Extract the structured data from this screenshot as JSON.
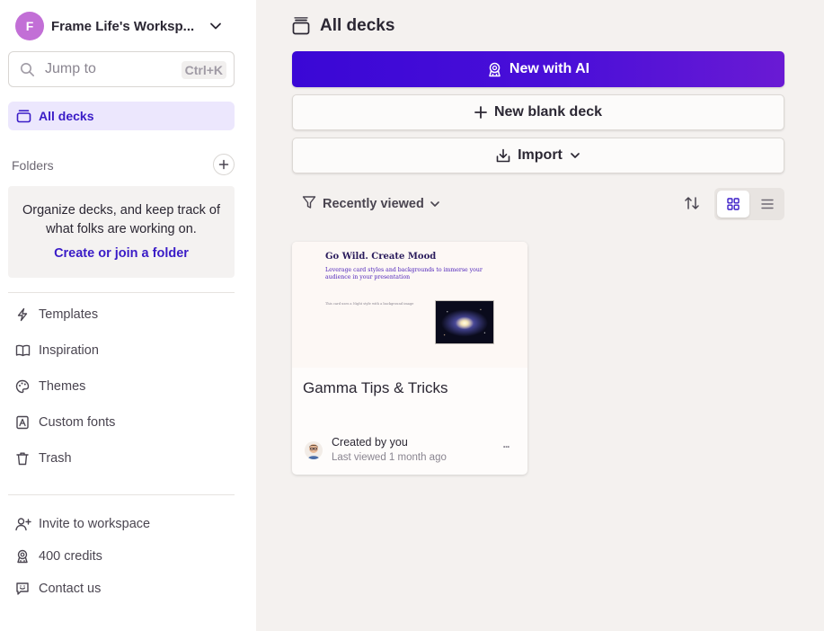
{
  "workspace": {
    "initial": "F",
    "name": "Frame Life's Worksp...",
    "avatar_color": "#c26fd6"
  },
  "search": {
    "placeholder": "Jump to",
    "shortcut": "Ctrl+K"
  },
  "sidebar": {
    "all_decks": "All decks",
    "folders_header": "Folders",
    "folders_message": "Organize decks, and keep track of what folks are working on.",
    "folders_link": "Create or join a folder",
    "nav": [
      {
        "label": "Templates",
        "icon": "bolt-icon"
      },
      {
        "label": "Inspiration",
        "icon": "book-icon"
      },
      {
        "label": "Themes",
        "icon": "palette-icon"
      },
      {
        "label": "Custom fonts",
        "icon": "font-icon"
      },
      {
        "label": "Trash",
        "icon": "trash-icon"
      }
    ],
    "footer": [
      {
        "label": "Invite to workspace",
        "icon": "invite-user-icon"
      },
      {
        "label": "400 credits",
        "icon": "credits-icon"
      },
      {
        "label": "Contact us",
        "icon": "chat-icon"
      }
    ]
  },
  "main": {
    "title": "All decks",
    "new_ai": "New with AI",
    "new_blank": "New blank deck",
    "import": "Import",
    "filter": "Recently viewed",
    "active_view": "grid"
  },
  "deck": {
    "thumb_title": "Go Wild. Create Mood",
    "thumb_subtitle": "Leverage card styles and backgrounds to immerse your audience in your presentation",
    "thumb_small": "This card uses a Night style with a background image",
    "title": "Gamma Tips & Tricks",
    "created_by": "Created by you",
    "last_viewed": "Last viewed 1 month ago",
    "more": "..."
  },
  "colors": {
    "accent": "#3a1cc7",
    "ai_gradient_start": "#3a07d6",
    "ai_gradient_end": "#6a1ad4",
    "main_bg": "#f4f1ef",
    "sidebar_active_bg": "#ece7fd"
  }
}
